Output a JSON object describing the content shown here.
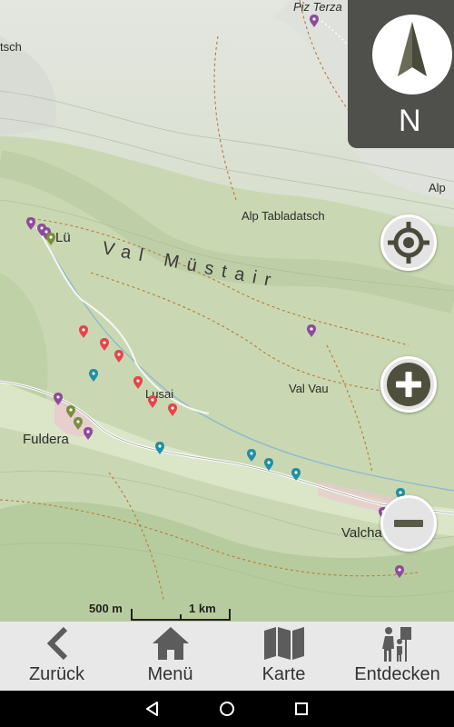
{
  "map": {
    "places": {
      "piz_terza": "Piz Terza",
      "tsch": "tsch",
      "lu": "Lü",
      "alp_tabladatsch": "Alp Tabladatsch",
      "alp": "Alp",
      "val_mustair": "Val Müstair",
      "lusai": "Lusai",
      "val_vau": "Val Vau",
      "fuldera": "Fuldera",
      "valcha": "Valcha"
    },
    "compass": {
      "letter": "N",
      "icon": "north-arrow-icon"
    },
    "controls": {
      "locate_icon": "crosshair-icon",
      "zoom_in_icon": "plus-icon",
      "zoom_out_icon": "minus-icon"
    },
    "scale": {
      "label_small": "500 m",
      "label_large": "1 km"
    },
    "marker_colors": {
      "red": "#e8434a",
      "purple": "#8e4a9b",
      "olive": "#7a8f3a",
      "teal": "#1f8fa3"
    }
  },
  "bottom_nav": {
    "items": [
      {
        "label": "Zurück",
        "icon": "chevron-left-icon"
      },
      {
        "label": "Menü",
        "icon": "home-icon"
      },
      {
        "label": "Karte",
        "icon": "map-icon"
      },
      {
        "label": "Entdecken",
        "icon": "hikers-icon"
      }
    ]
  },
  "system_bar": {
    "back": "back-icon",
    "home": "home-circle-icon",
    "recents": "recents-icon"
  }
}
